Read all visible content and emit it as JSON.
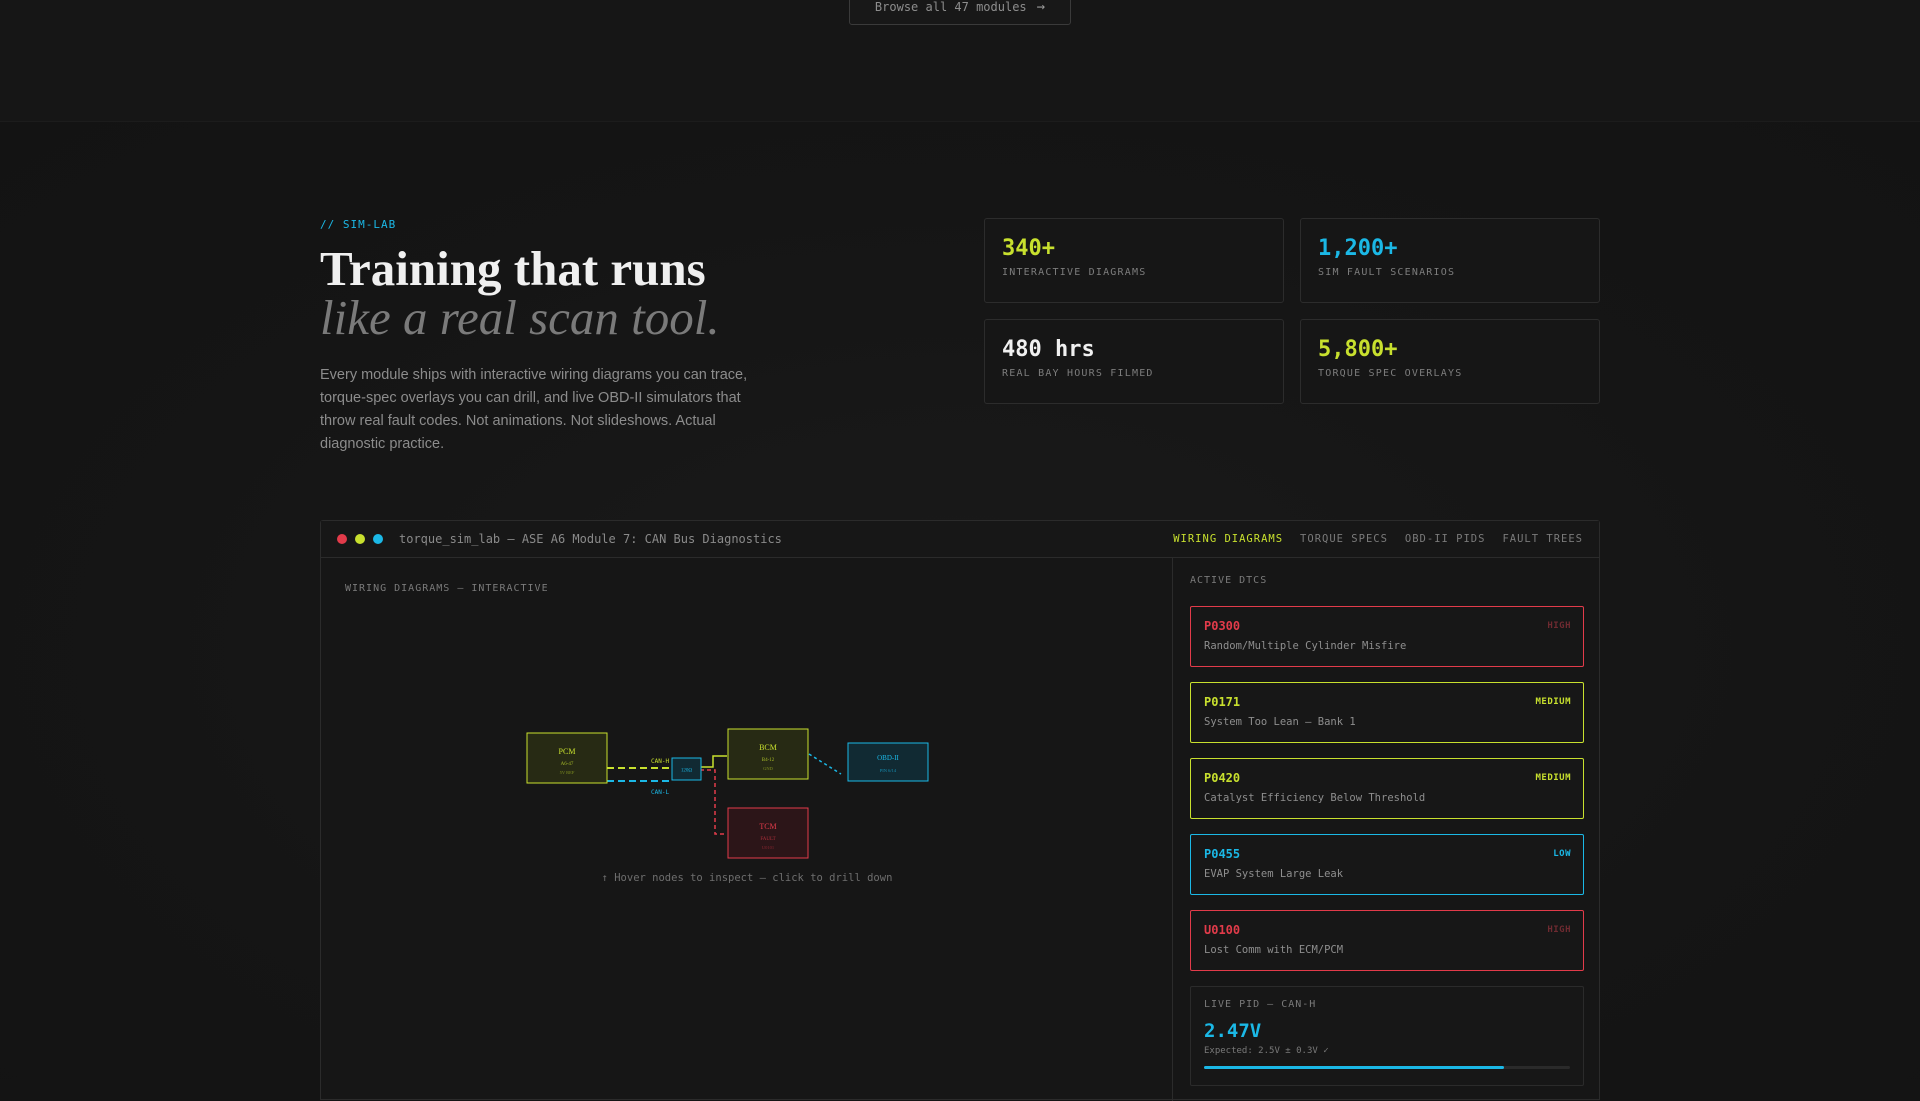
{
  "top": {
    "browse_label": "Browse all 47 modules"
  },
  "intro": {
    "eyebrow": "// SIM-LAB",
    "headline_1": "Training that runs",
    "headline_2": "like a real scan tool.",
    "lede": "Every module ships with interactive wiring diagrams you can trace, torque-spec overlays you can drill, and live OBD-II simulators that throw real fault codes. Not animations. Not slideshows. Actual diagnostic practice."
  },
  "stats": [
    {
      "value": "340+",
      "label": "INTERACTIVE DIAGRAMS",
      "color": "#c8e02e"
    },
    {
      "value": "1,200+",
      "label": "SIM FAULT SCENARIOS",
      "color": "#1bb8e6"
    },
    {
      "value": "480 hrs",
      "label": "REAL BAY HOURS FILMED",
      "color": "#f0f0f0"
    },
    {
      "value": "5,800+",
      "label": "TORQUE SPEC OVERLAYS",
      "color": "#c8e02e"
    }
  ],
  "window": {
    "title": "torque_sim_lab — ASE A6 Module 7: CAN Bus Diagnostics",
    "tabs": [
      "WIRING DIAGRAMS",
      "TORQUE SPECS",
      "OBD-II PIDS",
      "FAULT TREES"
    ],
    "active_tab": 0,
    "dots": [
      "#e23b4a",
      "#c8e02e",
      "#1bb8e6"
    ]
  },
  "diagram": {
    "label": "WIRING DIAGRAMS — INTERACTIVE",
    "hint": "↑ Hover nodes to inspect — click to drill down",
    "nodes": {
      "pcm": {
        "name": "PCM",
        "sub1": "A6-47",
        "sub2": "5V REF"
      },
      "gw": {
        "name": "120Ω"
      },
      "bcm": {
        "name": "BCM",
        "sub1": "B4-12",
        "sub2": "GND"
      },
      "obd": {
        "name": "OBD-II",
        "sub1": "PIN 6/14"
      },
      "tcm": {
        "name": "TCM",
        "sub1": "FAULT",
        "sub2": "U0101"
      }
    },
    "wires": {
      "can_h": "CAN-H",
      "can_l": "CAN-L"
    }
  },
  "dtcs": {
    "heading": "ACTIVE DTCS",
    "items": [
      {
        "code": "P0300",
        "desc": "Random/Multiple Cylinder Misfire",
        "severity": "HIGH",
        "color": "#e23b4a",
        "sev_color": "#6e2a30"
      },
      {
        "code": "P0171",
        "desc": "System Too Lean — Bank 1",
        "severity": "MEDIUM",
        "color": "#c8e02e",
        "sev_color": "#c8e02e"
      },
      {
        "code": "P0420",
        "desc": "Catalyst Efficiency Below Threshold",
        "severity": "MEDIUM",
        "color": "#c8e02e",
        "sev_color": "#c8e02e"
      },
      {
        "code": "P0455",
        "desc": "EVAP System Large Leak",
        "severity": "LOW",
        "color": "#1bb8e6",
        "sev_color": "#1bb8e6"
      },
      {
        "code": "U0100",
        "desc": "Lost Comm with ECM/PCM",
        "severity": "HIGH",
        "color": "#e23b4a",
        "sev_color": "#6e2a30"
      }
    ]
  },
  "pid": {
    "label": "LIVE PID — CAN-H",
    "value": "2.47V",
    "expected": "Expected: 2.5V ± 0.3V ✓",
    "level": 0.82
  }
}
